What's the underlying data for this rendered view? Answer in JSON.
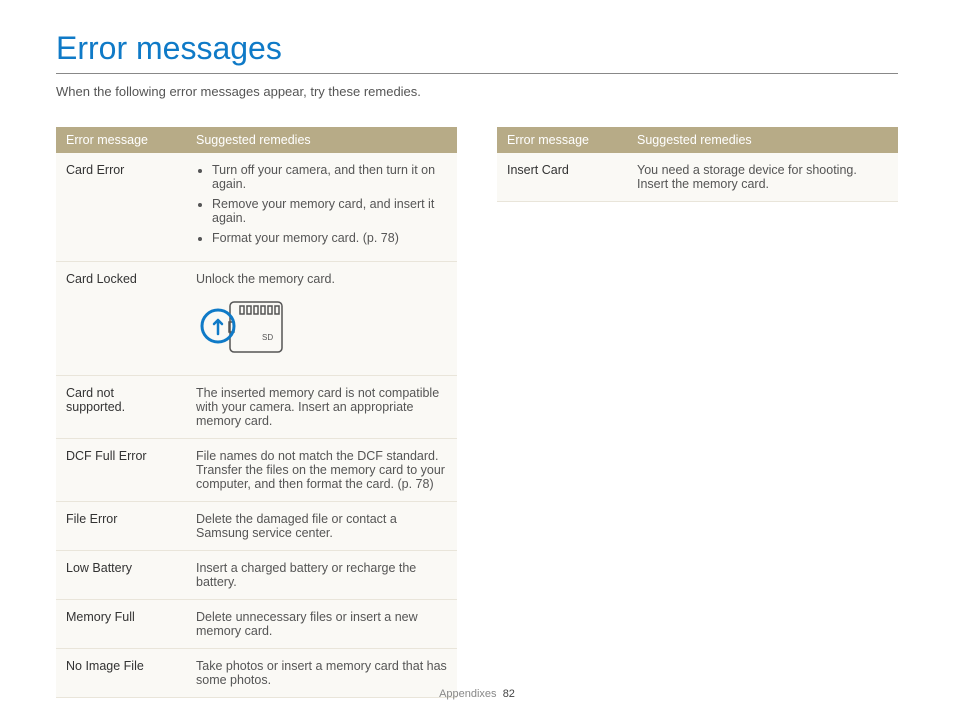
{
  "title": "Error messages",
  "intro": "When the following error messages appear, try these remedies.",
  "header": {
    "col1": "Error message",
    "col2": "Suggested remedies"
  },
  "left": [
    {
      "name": "Card Error",
      "type": "list",
      "remedies": [
        "Turn off your camera, and then turn it on again.",
        "Remove your memory card, and insert it again.",
        "Format your memory card. (p. 78)"
      ]
    },
    {
      "name": "Card Locked",
      "type": "sd",
      "text": "Unlock the memory card.",
      "sd_label": "SD"
    },
    {
      "name": "Card not supported.",
      "type": "text",
      "text": "The inserted memory card is not compatible with your camera. Insert an appropriate memory card."
    },
    {
      "name": "DCF Full Error",
      "type": "text",
      "text": "File names do not match the DCF standard. Transfer the files on the memory card to your computer, and then format the card. (p. 78)"
    },
    {
      "name": "File Error",
      "type": "text",
      "text": "Delete the damaged file or contact a Samsung service center."
    },
    {
      "name": "Low Battery",
      "type": "text",
      "text": "Insert a charged battery or recharge the battery."
    },
    {
      "name": "Memory Full",
      "type": "text",
      "text": "Delete unnecessary files or insert a new memory card."
    },
    {
      "name": "No Image File",
      "type": "text",
      "text": "Take photos or insert a memory card that has some photos."
    }
  ],
  "right": [
    {
      "name": "Insert Card",
      "type": "text",
      "text": "You need a storage device for shooting. Insert the memory card."
    }
  ],
  "footer": {
    "section": "Appendixes",
    "page": "82"
  }
}
